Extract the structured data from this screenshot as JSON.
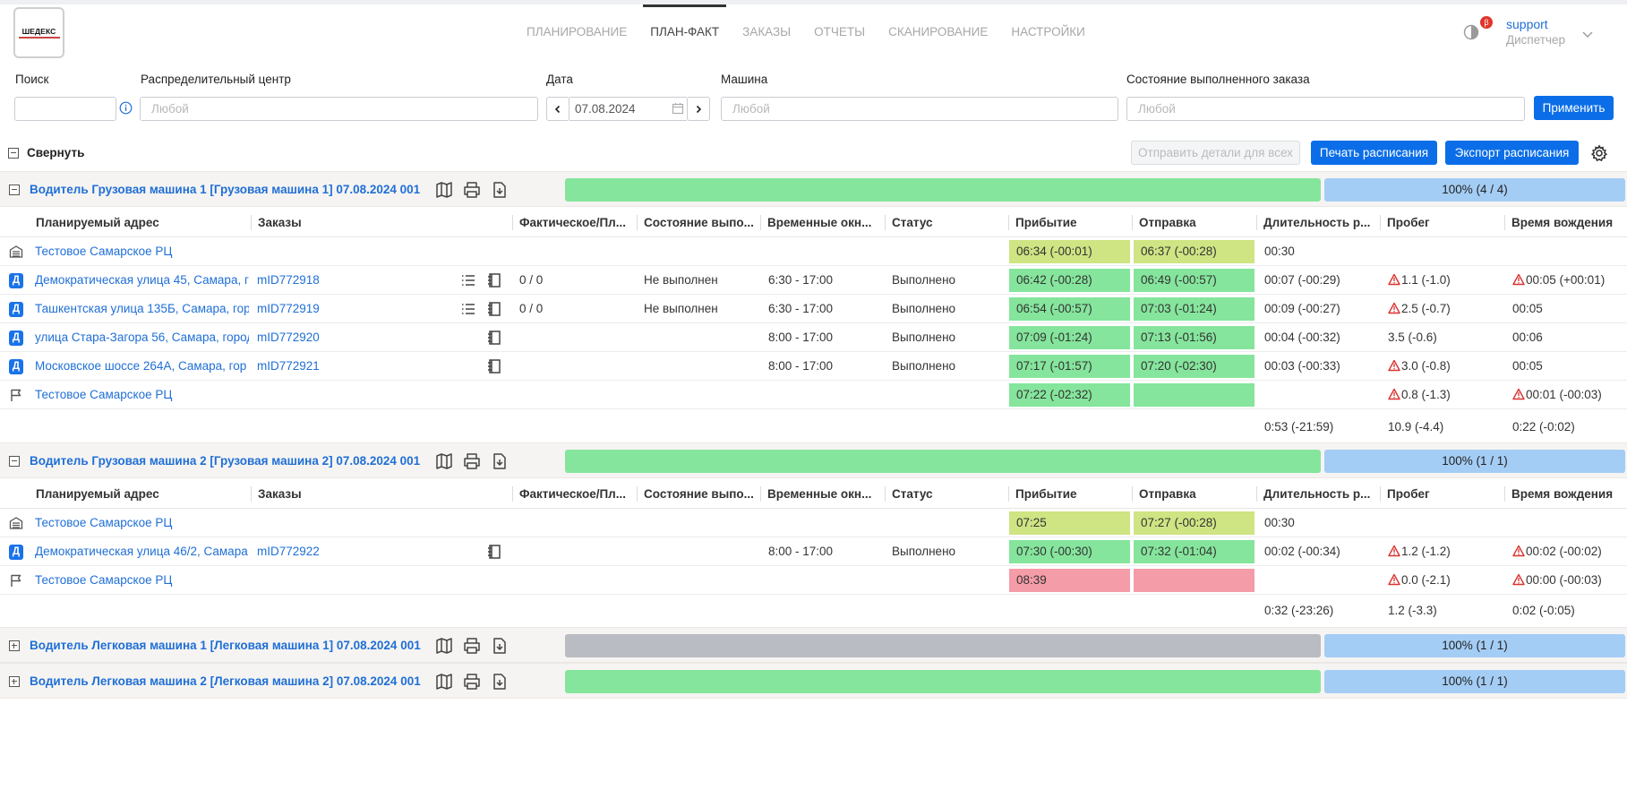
{
  "header": {
    "logo_text": "ШЕДЕКС",
    "nav": [
      "ПЛАНИРОВАНИЕ",
      "ПЛАН-ФАКТ",
      "ЗАКАЗЫ",
      "ОТЧЕТЫ",
      "СКАНИРОВАНИЕ",
      "НАСТРОЙКИ"
    ],
    "active_nav": "ПЛАН-ФАКТ",
    "beta": "β",
    "user_name": "support",
    "user_role": "Диспетчер"
  },
  "filters": {
    "search_label": "Поиск",
    "search_value": "",
    "dc_label": "Распределительный центр",
    "dc_placeholder": "Любой",
    "date_label": "Дата",
    "date_value": "07.08.2024",
    "vehicle_label": "Машина",
    "vehicle_placeholder": "Любой",
    "state_label": "Состояние выполненного заказа",
    "state_placeholder": "Любой",
    "apply": "Применить"
  },
  "toolbar": {
    "collapse_all": "Свернуть",
    "send_details": "Отправить детали для всех",
    "print_schedule": "Печать расписания",
    "export_schedule": "Экспорт расписания"
  },
  "columns": [
    "Планируемый адрес",
    "Заказы",
    "Фактическое/Пл...",
    "Состояние выпо...",
    "Временные окн...",
    "Статус",
    "Прибытие",
    "Отправка",
    "Длительность р...",
    "Пробег",
    "Время вождения"
  ],
  "colors": {
    "green": "#85e59c",
    "yellow": "#cfe483",
    "red": "#f49ca7",
    "gray_bar": "#b9bcc2",
    "blue_bar": "#a4cdf5",
    "link": "#1f6fd6"
  },
  "routes": [
    {
      "title": "Водитель Грузовая машина 1 [Грузовая машина 1]  07.08.2024 001",
      "bar_color": "green",
      "progress": "100% (4 / 4)",
      "rows": [
        {
          "icon": "depot-icon",
          "address": "Тестовое Самарское РЦ",
          "order": "",
          "has_list": false,
          "has_doc": false,
          "fact": "",
          "exec": "",
          "window": "",
          "status": "",
          "arrival": "06:34 (-00:01)",
          "arrival_color": "yellow",
          "departure": "06:37 (-00:28)",
          "departure_color": "yellow",
          "duration": "00:30",
          "mileage": "",
          "mileage_warn": false,
          "drive": "",
          "drive_warn": false
        },
        {
          "icon": "stop-badge",
          "badge": "Д",
          "address": "Демократическая улица 45, Самара, г",
          "order": "mID772918",
          "has_list": true,
          "has_doc": true,
          "fact": "0 / 0",
          "exec": "Не выполнен",
          "window": "6:30 - 17:00",
          "status": "Выполнено",
          "arrival": "06:42 (-00:28)",
          "arrival_color": "green",
          "departure": "06:49 (-00:57)",
          "departure_color": "green",
          "duration": "00:07 (-00:29)",
          "mileage": "1.1 (-1.0)",
          "mileage_warn": true,
          "drive": "00:05 (+00:01)",
          "drive_warn": true
        },
        {
          "icon": "stop-badge",
          "badge": "Д",
          "address": "Ташкентская улица 135Б, Самара, гор",
          "order": "mID772919",
          "has_list": true,
          "has_doc": true,
          "fact": "0 / 0",
          "exec": "Не выполнен",
          "window": "6:30 - 17:00",
          "status": "Выполнено",
          "arrival": "06:54 (-00:57)",
          "arrival_color": "green",
          "departure": "07:03 (-01:24)",
          "departure_color": "green",
          "duration": "00:09 (-00:27)",
          "mileage": "2.5 (-0.7)",
          "mileage_warn": true,
          "drive": "00:05",
          "drive_warn": false
        },
        {
          "icon": "stop-badge",
          "badge": "Д",
          "address": "улица Стара-Загора 56, Самара, город",
          "order": "mID772920",
          "has_list": false,
          "has_doc": true,
          "fact": "",
          "exec": "",
          "window": "8:00 - 17:00",
          "status": "Выполнено",
          "arrival": "07:09 (-01:24)",
          "arrival_color": "green",
          "departure": "07:13 (-01:56)",
          "departure_color": "green",
          "duration": "00:04 (-00:32)",
          "mileage": "3.5 (-0.6)",
          "mileage_warn": false,
          "drive": "00:06",
          "drive_warn": false
        },
        {
          "icon": "stop-badge",
          "badge": "Д",
          "address": "Московское шоссе 264А, Самара, гор",
          "order": "mID772921",
          "has_list": false,
          "has_doc": true,
          "fact": "",
          "exec": "",
          "window": "8:00 - 17:00",
          "status": "Выполнено",
          "arrival": "07:17 (-01:57)",
          "arrival_color": "green",
          "departure": "07:20 (-02:30)",
          "departure_color": "green",
          "duration": "00:03 (-00:33)",
          "mileage": "3.0 (-0.8)",
          "mileage_warn": true,
          "drive": "00:05",
          "drive_warn": false
        },
        {
          "icon": "flag-icon",
          "address": "Тестовое Самарское РЦ",
          "order": "",
          "has_list": false,
          "has_doc": false,
          "fact": "",
          "exec": "",
          "window": "",
          "status": "",
          "arrival": "07:22 (-02:32)",
          "arrival_color": "green",
          "departure": "",
          "departure_color": "green",
          "duration": "",
          "mileage": "0.8 (-1.3)",
          "mileage_warn": true,
          "drive": "00:01 (-00:03)",
          "drive_warn": true
        }
      ],
      "totals": {
        "duration": "0:53 (-21:59)",
        "mileage": "10.9 (-4.4)",
        "drive": "0:22 (-0:02)"
      }
    },
    {
      "title": "Водитель Грузовая машина 2 [Грузовая машина 2]  07.08.2024 001",
      "bar_color": "green",
      "progress": "100% (1 / 1)",
      "rows": [
        {
          "icon": "depot-icon",
          "address": "Тестовое Самарское РЦ",
          "order": "",
          "has_list": false,
          "has_doc": false,
          "fact": "",
          "exec": "",
          "window": "",
          "status": "",
          "arrival": "07:25",
          "arrival_color": "yellow",
          "departure": "07:27 (-00:28)",
          "departure_color": "yellow",
          "duration": "00:30",
          "mileage": "",
          "mileage_warn": false,
          "drive": "",
          "drive_warn": false
        },
        {
          "icon": "stop-badge",
          "badge": "Д",
          "address": "Демократическая улица 46/2, Самара",
          "order": "mID772922",
          "has_list": false,
          "has_doc": true,
          "fact": "",
          "exec": "",
          "window": "8:00 - 17:00",
          "status": "Выполнено",
          "arrival": "07:30 (-00:30)",
          "arrival_color": "green",
          "departure": "07:32 (-01:04)",
          "departure_color": "green",
          "duration": "00:02 (-00:34)",
          "mileage": "1.2 (-1.2)",
          "mileage_warn": true,
          "drive": "00:02 (-00:02)",
          "drive_warn": true
        },
        {
          "icon": "flag-icon",
          "address": "Тестовое Самарское РЦ",
          "order": "",
          "has_list": false,
          "has_doc": false,
          "fact": "",
          "exec": "",
          "window": "",
          "status": "",
          "arrival": "08:39",
          "arrival_color": "red",
          "departure": "",
          "departure_color": "red",
          "duration": "",
          "mileage": "0.0 (-2.1)",
          "mileage_warn": true,
          "drive": "00:00 (-00:03)",
          "drive_warn": true
        }
      ],
      "totals": {
        "duration": "0:32 (-23:26)",
        "mileage": "1.2 (-3.3)",
        "drive": "0:02 (-0:05)"
      }
    },
    {
      "title": "Водитель Легковая машина 1 [Легковая машина 1]  07.08.2024 001",
      "bar_color": "gray",
      "progress": "100% (1 / 1)",
      "collapsed": true
    },
    {
      "title": "Водитель Легковая машина 2 [Легковая машина 2]  07.08.2024 001",
      "bar_color": "green",
      "progress": "100% (1 / 1)",
      "collapsed": true
    }
  ]
}
